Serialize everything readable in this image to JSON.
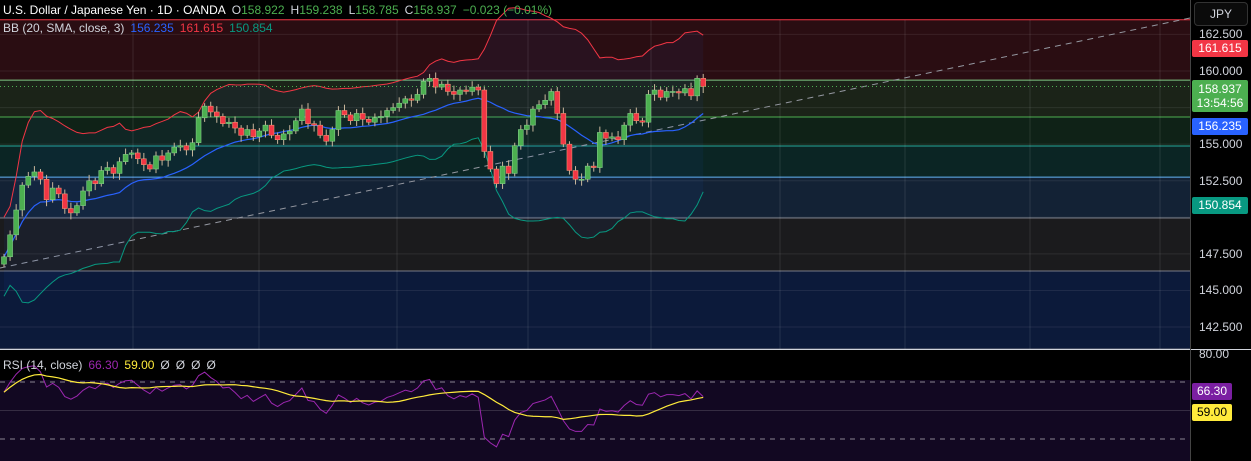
{
  "header": {
    "symbol": "U.S. Dollar / Japanese Yen · 1D · OANDA",
    "o_label": "O",
    "open": "158.922",
    "h_label": "H",
    "high": "159.238",
    "l_label": "L",
    "low": "158.785",
    "c_label": "C",
    "close": "158.937",
    "change": "−0.023 (−0.01%)"
  },
  "bb": {
    "label": "BB (20, SMA, close, 3)",
    "basis": "156.235",
    "upper": "161.615",
    "lower": "150.854"
  },
  "rsi": {
    "label": "RSI (14, close)",
    "value": "66.30",
    "ma": "59.00",
    "extras": [
      "Ø",
      "Ø",
      "Ø",
      "Ø"
    ],
    "scale_top": "80.00"
  },
  "price_scale": {
    "currency": "JPY",
    "ticks": [
      {
        "price": 162.5,
        "label": "162.500"
      },
      {
        "price": 160,
        "label": "160.000"
      },
      {
        "price": 155,
        "label": "155.000"
      },
      {
        "price": 152.5,
        "label": "152.500"
      },
      {
        "price": 147.5,
        "label": "147.500"
      },
      {
        "price": 145,
        "label": "145.000"
      },
      {
        "price": 142.5,
        "label": "142.500"
      }
    ],
    "last_price": "158.937",
    "countdown": "13:54:56"
  },
  "colors": {
    "up": "#4caf50",
    "down": "#f23645",
    "basis": "#2962ff",
    "upper": "#f23645",
    "lower": "#089981",
    "rsi": "#9c27b0",
    "rsi_ma": "#ffeb3b"
  },
  "levels": [
    {
      "price": 163.5,
      "fill": "#2a0d12",
      "line": "#f23645"
    },
    {
      "price": 159.38,
      "fill": "#1b2318",
      "line": "#81c784"
    },
    {
      "price": 156.86,
      "fill": "#0f2217",
      "line": "#4caf50"
    },
    {
      "price": 154.87,
      "fill": "#0b2524",
      "line": "#26a69a"
    },
    {
      "price": 152.75,
      "fill": "#132235",
      "line": "#64b5f6"
    },
    {
      "price": 149.95,
      "fill": "#1b1b1d",
      "line": "#787b86"
    },
    {
      "price": 146.33,
      "fill": "#0c1a3a",
      "line": "#787b86"
    },
    {
      "price": 141.0,
      "fill": "#0c1a3a",
      "line": "#787b86"
    }
  ],
  "chart_data": {
    "type": "candlestick",
    "first_open": 146.8,
    "closes": [
      147.3,
      148.8,
      150.5,
      152.2,
      152.8,
      153.1,
      152.6,
      151.2,
      152.0,
      151.6,
      150.6,
      150.3,
      150.8,
      151.8,
      152.5,
      152.3,
      153.2,
      153.4,
      153.0,
      153.8,
      154.3,
      154.4,
      154.0,
      153.6,
      153.3,
      154.2,
      153.9,
      154.4,
      154.8,
      154.9,
      154.6,
      155.1,
      156.8,
      157.6,
      157.2,
      156.9,
      156.4,
      156.5,
      156.1,
      155.6,
      156.0,
      155.5,
      155.9,
      156.3,
      155.6,
      155.3,
      155.7,
      155.9,
      156.6,
      157.4,
      156.4,
      156.3,
      155.6,
      155.2,
      156.0,
      157.3,
      157.0,
      156.6,
      157.1,
      156.7,
      156.5,
      156.8,
      156.9,
      157.3,
      157.5,
      157.8,
      158.1,
      158.0,
      158.4,
      159.3,
      159.5,
      158.9,
      159.1,
      158.6,
      158.4,
      158.7,
      158.6,
      158.9,
      158.7,
      154.5,
      153.3,
      152.3,
      153.5,
      153.0,
      154.9,
      156.0,
      156.3,
      157.4,
      157.7,
      158.0,
      158.6,
      157.1,
      155.0,
      153.2,
      152.6,
      152.6,
      153.5,
      153.4,
      155.8,
      155.4,
      155.5,
      155.3,
      156.3,
      157.1,
      156.6,
      156.5,
      158.4,
      158.7,
      158.2,
      158.6,
      158.6,
      158.5,
      158.8,
      158.3,
      159.5,
      158.937
    ],
    "ylim": [
      141.0,
      163.5
    ],
    "rsi_levels": [
      70,
      50,
      30
    ]
  }
}
